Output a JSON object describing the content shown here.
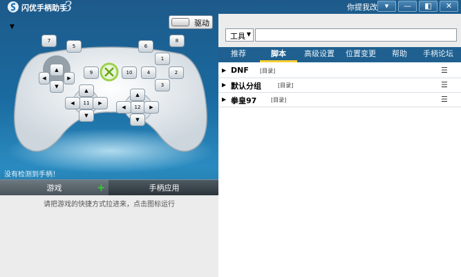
{
  "app": {
    "title": "闪优手柄助手",
    "title_suffix": "3",
    "greeting": "你提我改",
    "window_buttons": [
      "▾",
      "—",
      "◧",
      "✕"
    ]
  },
  "left": {
    "drive_label": "驱动",
    "no_controller": "没有检测到手柄！",
    "controller_buttons": [
      "1",
      "2",
      "3",
      "4",
      "5",
      "6",
      "7",
      "8",
      "9",
      "10",
      "11",
      "12"
    ],
    "tabs": {
      "games": "游戏",
      "apps": "手柄应用"
    },
    "games_plus": "+",
    "hint": "请把游戏的快捷方式拉进来，点击图标运行"
  },
  "right": {
    "combo_value": "工具",
    "search_value": "",
    "tabs": [
      "推荐",
      "脚本",
      "高级设置",
      "位置变更",
      "帮助",
      "手柄论坛"
    ],
    "active_tab": "脚本",
    "rows": [
      {
        "name": "DNF",
        "tag": "[目录]"
      },
      {
        "name": "默认分组",
        "tag": "[目录]"
      },
      {
        "name": "拳皇97",
        "tag": "[目录]"
      }
    ]
  },
  "icons": {
    "logo": "app-logo-icon",
    "menu": "dropdown-triangle-icon",
    "row_expand": "expand-triangle-icon",
    "row_menu": "list-menu-icon",
    "xbox": "xbox-guide-icon",
    "add": "plus-icon"
  },
  "colors": {
    "accent": "#1f6090",
    "active_tab_underline": "#ffcf33",
    "plus": "#33cc33"
  }
}
